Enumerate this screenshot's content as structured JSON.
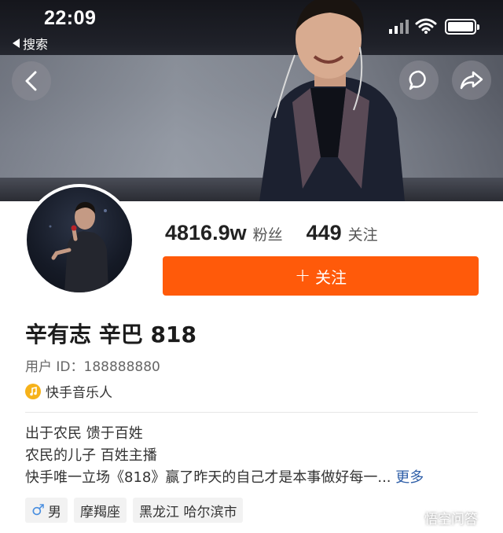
{
  "status_bar": {
    "time": "22:09",
    "back_app_label": "搜索",
    "icons": [
      "signal-icon",
      "wifi-icon",
      "battery-icon"
    ]
  },
  "nav": {
    "icons": [
      "back-arrow-icon",
      "comment-icon",
      "share-icon"
    ]
  },
  "profile": {
    "followers_count": "4816.9w",
    "followers_label": "粉丝",
    "following_count": "449",
    "following_label": "关注",
    "follow_button_icon": "+",
    "follow_button_label": "关注",
    "name": "辛有志 辛巴 818",
    "user_id": "用户 ID：188888880",
    "badge_label": "快手音乐人",
    "bio": [
      "出于农民 馈于百姓",
      "农民的儿子  百姓主播",
      "快手唯一立场《818》赢了昨天的自己才是本事做好每一..."
    ],
    "bio_more": "更多",
    "tags": {
      "gender": "男",
      "zodiac": "摩羯座",
      "location": "黑龙江 哈尔滨市"
    }
  },
  "watermark": "悟空问答",
  "colors": {
    "accent": "#ff5a0a",
    "link": "#2f5fa8",
    "badge": "#f6b21a"
  }
}
